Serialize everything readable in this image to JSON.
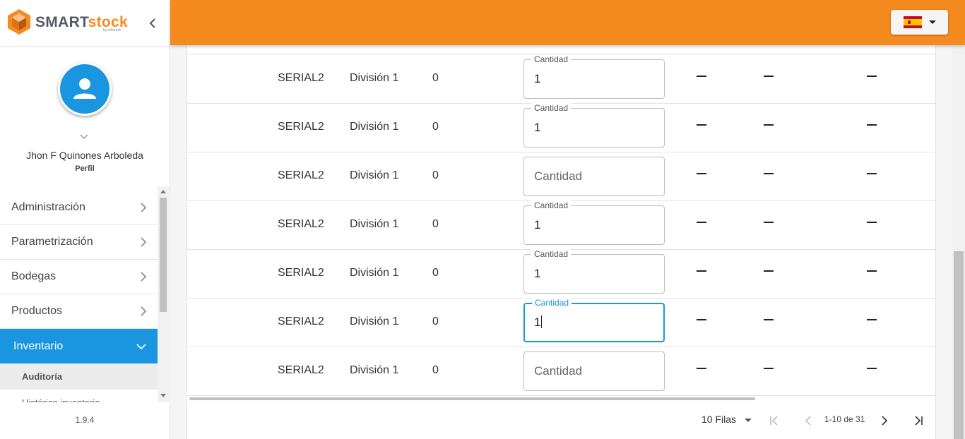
{
  "brand": {
    "name_part1": "SMART",
    "name_part2": "stock",
    "byline": "by infotrack"
  },
  "user": {
    "name": "Jhon F Quinones Arboleda",
    "profile_link": "Perfil"
  },
  "menu": {
    "items": [
      {
        "label": "Administración"
      },
      {
        "label": "Parametrización"
      },
      {
        "label": "Bodegas"
      },
      {
        "label": "Productos"
      },
      {
        "label": "Inventario"
      }
    ],
    "active_index": 4,
    "submenu": [
      {
        "label": "Auditoría"
      },
      {
        "label": "Histórico inventario"
      }
    ]
  },
  "version": "1.9.4",
  "header": {
    "language_flag": "spain-flag-icon"
  },
  "table": {
    "rows": [
      {
        "serial": "SERIAL2",
        "division": "División 1",
        "qty": "0",
        "field_label": "Cantidad",
        "field_value": "1",
        "field_placeholder": ""
      },
      {
        "serial": "SERIAL2",
        "division": "División 1",
        "qty": "0",
        "field_label": "Cantidad",
        "field_value": "1",
        "field_placeholder": ""
      },
      {
        "serial": "SERIAL2",
        "division": "División 1",
        "qty": "0",
        "field_label": "",
        "field_value": "",
        "field_placeholder": "Cantidad"
      },
      {
        "serial": "SERIAL2",
        "division": "División 1",
        "qty": "0",
        "field_label": "Cantidad",
        "field_value": "1",
        "field_placeholder": ""
      },
      {
        "serial": "SERIAL2",
        "division": "División 1",
        "qty": "0",
        "field_label": "Cantidad",
        "field_value": "1",
        "field_placeholder": ""
      },
      {
        "serial": "SERIAL2",
        "division": "División 1",
        "qty": "0",
        "field_label": "Cantidad",
        "field_value": "1",
        "field_placeholder": ""
      },
      {
        "serial": "SERIAL2",
        "division": "División 1",
        "qty": "0",
        "field_label": "",
        "field_value": "",
        "field_placeholder": "Cantidad"
      }
    ],
    "focused_row": 5
  },
  "pagination": {
    "rows_per_page": "10 Filas",
    "range": "1-10 de 31"
  },
  "colors": {
    "accent": "#f58a1f",
    "primary": "#1a95e0"
  }
}
